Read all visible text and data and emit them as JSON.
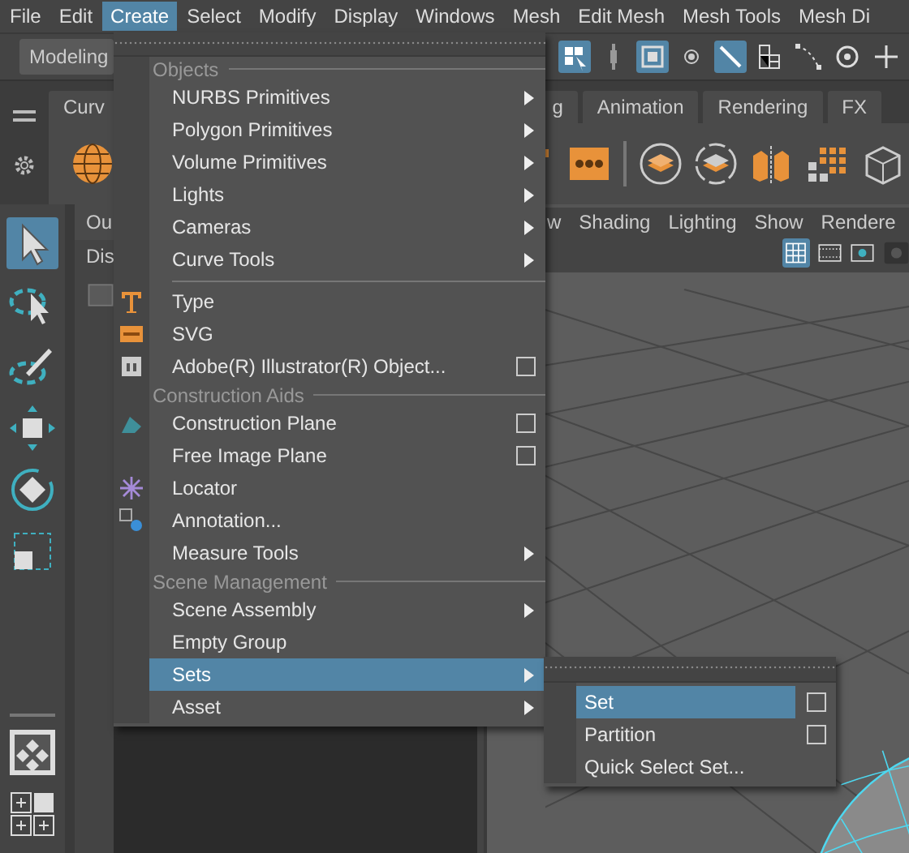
{
  "menubar": [
    {
      "label": "File",
      "selected": false
    },
    {
      "label": "Edit",
      "selected": false
    },
    {
      "label": "Create",
      "selected": true
    },
    {
      "label": "Select",
      "selected": false
    },
    {
      "label": "Modify",
      "selected": false
    },
    {
      "label": "Display",
      "selected": false
    },
    {
      "label": "Windows",
      "selected": false
    },
    {
      "label": "Mesh",
      "selected": false
    },
    {
      "label": "Edit Mesh",
      "selected": false
    },
    {
      "label": "Mesh Tools",
      "selected": false
    },
    {
      "label": "Mesh Di",
      "selected": false
    }
  ],
  "mode_selector": "Modeling",
  "status_tools": [
    {
      "selected": true
    },
    {
      "selected": false
    },
    {
      "selected": true
    },
    {
      "selected": false
    },
    {
      "selected": true
    },
    {
      "selected": false
    },
    {
      "selected": false
    },
    {
      "selected": false
    },
    {
      "selected": false
    }
  ],
  "shelf_tabs_left": [
    "Curv"
  ],
  "shelf_tabs_right": [
    "g",
    "Animation",
    "Rendering",
    "FX"
  ],
  "toolbox": [
    {
      "selected": true
    },
    {
      "selected": false
    },
    {
      "selected": false
    },
    {
      "selected": false
    },
    {
      "selected": false
    },
    {
      "selected": false
    }
  ],
  "outliner": {
    "tab": "Ou",
    "menu": "Dis"
  },
  "viewport": {
    "menus": [
      "w",
      "Shading",
      "Lighting",
      "Show",
      "Rendere"
    ]
  },
  "create_menu": {
    "sections": [
      {
        "heading": "Objects",
        "items": [
          {
            "label": "NURBS Primitives",
            "submenu": true,
            "option_box": false,
            "selected": false
          },
          {
            "label": "Polygon Primitives",
            "submenu": true,
            "option_box": false,
            "selected": false
          },
          {
            "label": "Volume Primitives",
            "submenu": true,
            "option_box": false,
            "selected": false
          },
          {
            "label": "Lights",
            "submenu": true,
            "option_box": false,
            "selected": false
          },
          {
            "label": "Cameras",
            "submenu": true,
            "option_box": false,
            "selected": false
          },
          {
            "label": "Curve Tools",
            "submenu": true,
            "option_box": false,
            "selected": false
          }
        ]
      },
      {
        "items": [
          {
            "label": "Type",
            "submenu": false,
            "option_box": false,
            "selected": false
          },
          {
            "label": "SVG",
            "submenu": false,
            "option_box": false,
            "selected": false
          },
          {
            "label": "Adobe(R) Illustrator(R) Object...",
            "submenu": false,
            "option_box": true,
            "selected": false
          }
        ]
      },
      {
        "heading": "Construction Aids",
        "items": [
          {
            "label": "Construction Plane",
            "submenu": false,
            "option_box": true,
            "selected": false
          },
          {
            "label": "Free Image Plane",
            "submenu": false,
            "option_box": true,
            "selected": false
          },
          {
            "label": "Locator",
            "submenu": false,
            "option_box": false,
            "selected": false
          },
          {
            "label": "Annotation...",
            "submenu": false,
            "option_box": false,
            "selected": false
          },
          {
            "label": "Measure Tools",
            "submenu": true,
            "option_box": false,
            "selected": false
          }
        ]
      },
      {
        "heading": "Scene Management",
        "items": [
          {
            "label": "Scene Assembly",
            "submenu": true,
            "option_box": false,
            "selected": false
          },
          {
            "label": "Empty Group",
            "submenu": false,
            "option_box": false,
            "selected": false
          },
          {
            "label": "Sets",
            "submenu": true,
            "option_box": false,
            "selected": true
          },
          {
            "label": "Asset",
            "submenu": true,
            "option_box": false,
            "selected": false
          }
        ]
      }
    ]
  },
  "sets_submenu": {
    "items": [
      {
        "label": "Set",
        "option_box": true,
        "selected": true
      },
      {
        "label": "Partition",
        "option_box": true,
        "selected": false
      },
      {
        "label": "Quick Select Set...",
        "option_box": false,
        "selected": false
      }
    ]
  }
}
